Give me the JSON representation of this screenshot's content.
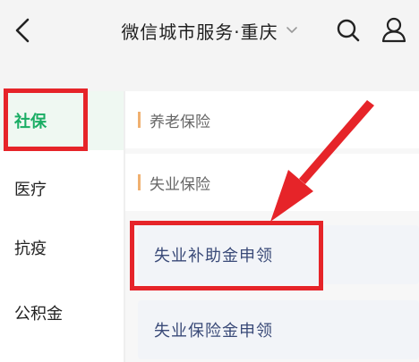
{
  "header": {
    "title": "微信城市服务·重庆",
    "icons": {
      "back": "chevron-left-icon",
      "dropdown": "chevron-down-icon",
      "search": "search-icon",
      "user": "user-icon"
    }
  },
  "sidebar": {
    "items": [
      {
        "label": "社保",
        "active": true
      },
      {
        "label": "医疗",
        "active": false
      },
      {
        "label": "抗疫",
        "active": false
      },
      {
        "label": "公积金",
        "active": false
      }
    ]
  },
  "main": {
    "sections": [
      {
        "title": "养老保险"
      },
      {
        "title": "失业保险"
      }
    ],
    "cards": [
      {
        "label": "失业补助金申领"
      },
      {
        "label": "失业保险金申领"
      }
    ]
  },
  "colors": {
    "active_green": "#1aad64",
    "annotation_red": "#e62429",
    "section_bar": "#f0b070",
    "card_text": "#3a4a78"
  }
}
